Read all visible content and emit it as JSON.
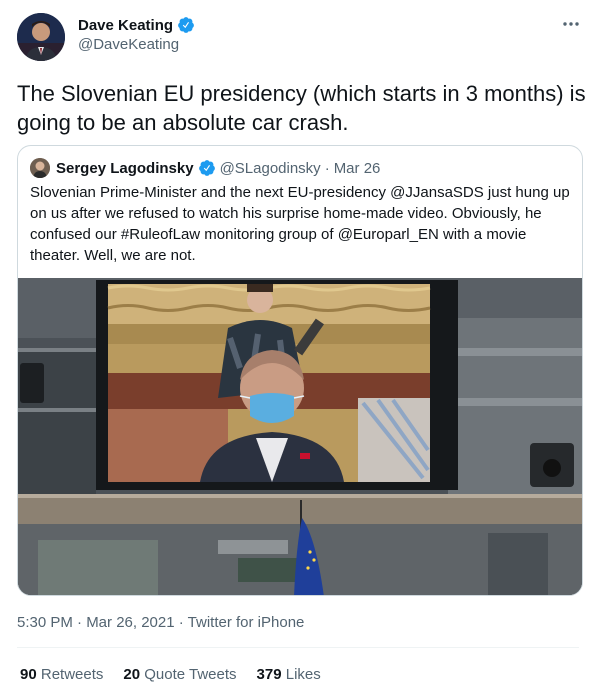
{
  "tweet": {
    "author_name": "Dave Keating",
    "author_handle": "@DaveKeating",
    "text": "The Slovenian EU presidency (which starts in 3 months) is going to be an absolute car crash.",
    "timestamp": "5:30 PM · Mar 26, 2021",
    "source": "Twitter for iPhone"
  },
  "quoted_tweet": {
    "author_name": "Sergey Lagodinsky",
    "author_handle": "@SLagodinsky",
    "separator": "·",
    "date": "Mar 26",
    "text": "Slovenian Prime-Minister and the next EU-presidency @JJansaSDS just hung up on us after we refused to watch his surprise home-made video. Obviously, he confused our #RuleofLaw monitoring group of @Europarl_EN with a movie theater. Well, we are not."
  },
  "stats": {
    "retweets_count": "90",
    "retweets_label": "Retweets",
    "quote_tweets_count": "20",
    "quote_tweets_label": "Quote Tweets",
    "likes_count": "379",
    "likes_label": "Likes"
  },
  "colors": {
    "verified": "#1d9bf0",
    "secondary_text": "#536471",
    "border": "#cfd9de"
  },
  "icons": {
    "verified": "verified-badge-icon",
    "more": "more-horizontal-icon"
  }
}
